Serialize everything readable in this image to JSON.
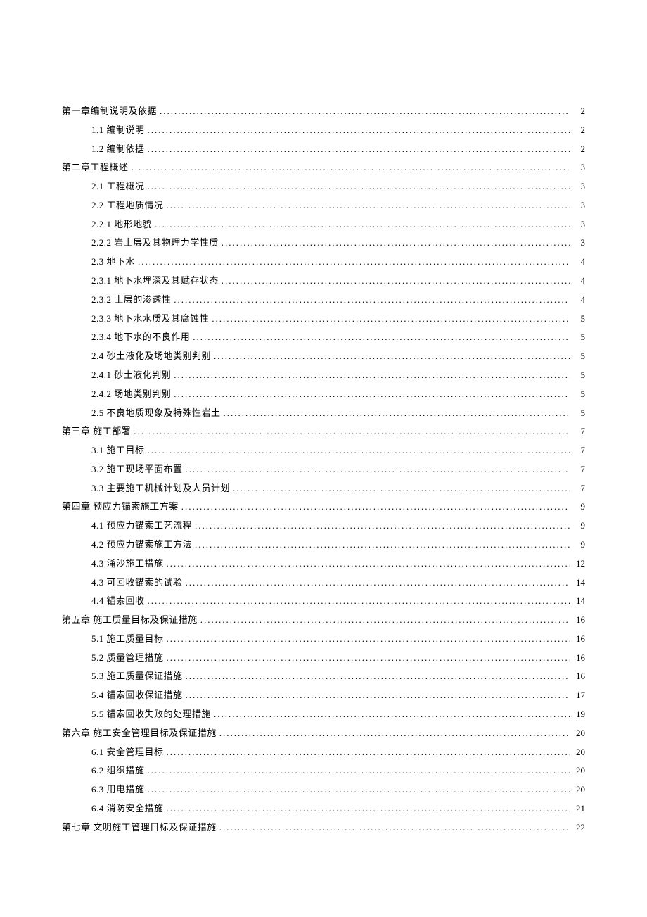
{
  "toc": [
    {
      "level": 0,
      "title": "第一章编制说明及依据",
      "page": "2"
    },
    {
      "level": 1,
      "title": "1.1 编制说明",
      "page": "2"
    },
    {
      "level": 1,
      "title": "1.2 编制依据",
      "page": "2"
    },
    {
      "level": 0,
      "title": "第二章工程概述",
      "page": "3"
    },
    {
      "level": 1,
      "title": "2.1 工程概况",
      "page": "3"
    },
    {
      "level": 1,
      "title": "2.2 工程地质情况",
      "page": "3"
    },
    {
      "level": 1,
      "title": "2.2.1  地形地貌",
      "page": "3"
    },
    {
      "level": 1,
      "title": "2.2.2 岩土层及其物理力学性质",
      "page": "3"
    },
    {
      "level": 1,
      "title": "2.3 地下水",
      "page": "4"
    },
    {
      "level": 1,
      "title": "2.3.1 地下水埋深及其赋存状态",
      "page": "4"
    },
    {
      "level": 1,
      "title": "2.3.2  土层的渗透性",
      "page": "4"
    },
    {
      "level": 1,
      "title": "2.3.3 地下水水质及其腐蚀性",
      "page": "5"
    },
    {
      "level": 1,
      "title": "2.3.4 地下水的不良作用",
      "page": "5"
    },
    {
      "level": 1,
      "title": "2.4 砂土液化及场地类别判别",
      "page": "5"
    },
    {
      "level": 1,
      "title": "2.4.1 砂土液化判别",
      "page": "5"
    },
    {
      "level": 1,
      "title": "2.4.2 场地类别判别",
      "page": "5"
    },
    {
      "level": 1,
      "title": "2.5 不良地质现象及特殊性岩土",
      "page": "5"
    },
    {
      "level": 0,
      "title": "第三章  施工部署",
      "page": "7"
    },
    {
      "level": 1,
      "title": "3.1 施工目标",
      "page": "7"
    },
    {
      "level": 1,
      "title": "3.2 施工现场平面布置",
      "page": "7"
    },
    {
      "level": 1,
      "title": "3.3 主要施工机械计划及人员计划",
      "page": "7"
    },
    {
      "level": 0,
      "title": "第四章  预应力锚索施工方案",
      "page": "9"
    },
    {
      "level": 1,
      "title": "4.1 预应力锚索工艺流程",
      "page": "9"
    },
    {
      "level": 1,
      "title": "4.2 预应力锚索施工方法",
      "page": "9"
    },
    {
      "level": 1,
      "title": "4.3 涌沙施工措施",
      "page": "12"
    },
    {
      "level": 1,
      "title": "4.3 可回收锚索的试验",
      "page": "14"
    },
    {
      "level": 1,
      "title": "4.4 锚索回收",
      "page": "14"
    },
    {
      "level": 0,
      "title": "第五章  施工质量目标及保证措施",
      "page": "16"
    },
    {
      "level": 1,
      "title": "5.1  施工质量目标",
      "page": "16"
    },
    {
      "level": 1,
      "title": "5.2 质量管理措施",
      "page": "16"
    },
    {
      "level": 1,
      "title": "5.3 施工质量保证措施",
      "page": "16"
    },
    {
      "level": 1,
      "title": "5.4 锚索回收保证措施",
      "page": "17"
    },
    {
      "level": 1,
      "title": "5.5 锚索回收失败的处理措施",
      "page": "19"
    },
    {
      "level": 0,
      "title": "第六章  施工安全管理目标及保证措施",
      "page": "20"
    },
    {
      "level": 1,
      "title": "6.1 安全管理目标",
      "page": "20"
    },
    {
      "level": 1,
      "title": "6.2 组织措施",
      "page": "20"
    },
    {
      "level": 1,
      "title": "6.3 用电措施",
      "page": "20"
    },
    {
      "level": 1,
      "title": "6.4 消防安全措施",
      "page": "21"
    },
    {
      "level": 0,
      "title": "第七章  文明施工管理目标及保证措施",
      "page": "22"
    }
  ]
}
